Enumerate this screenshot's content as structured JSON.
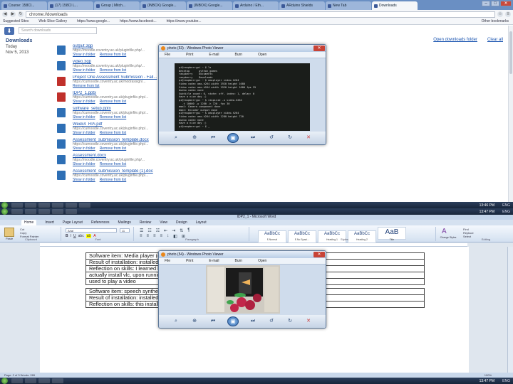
{
  "browser": {
    "tabs": [
      "Course: 158CI...",
      "(17) 158CI L...",
      "Group | Mitch...",
      "(INBOX) Google...",
      "(INBOX) Google...",
      "Arduino / Eth...",
      "ARduino Shields",
      "New Tab",
      "Downloads"
    ],
    "active_tab": 8,
    "address": "chrome://downloads",
    "bookmarks": [
      "Suggested Sites",
      "Web Slice Gallery",
      "https://www.google...",
      "https://www.facebook...",
      "https://www.youtube..."
    ],
    "other_bookmarks": "Other bookmarks",
    "window_buttons": {
      "min": "–",
      "max": "□",
      "close": "✕"
    }
  },
  "downloads": {
    "search_placeholder": "Search downloads",
    "title": "Downloads",
    "open_folder": "Open downloads folder",
    "clear_all": "Clear all",
    "date_label": "Today",
    "date_value": "Nov 5, 2013",
    "items": [
      {
        "name": "output.3gp",
        "url": "https://moodle.coventry.ac.uk/pluginfile.php/...",
        "show": "Show in folder",
        "remove": "Remove from list",
        "icon_color": "#2e6fb5"
      },
      {
        "name": "video.3gp",
        "url": "https://moodle.coventry.ac.uk/pluginfile.php/...",
        "show": "Show in folder",
        "remove": "Remove from list",
        "icon_color": "#2e6fb5"
      },
      {
        "name": "Project One Assessment Submission - Fall...",
        "url": "https://cumoodle.coventry.ac.uk/mod/assign/...",
        "show": "Remove from list",
        "remove": "",
        "icon_color": "#c0302b"
      },
      {
        "name": "IDP2_1.pptx",
        "url": "https://cumoodle.coventry.ac.uk/pluginfile.php/...",
        "show": "Show in folder",
        "remove": "Remove from list",
        "icon_color": "#c0302b"
      },
      {
        "name": "software_setup.pptx",
        "url": "https://cumoodle.coventry.ac.uk/pluginfile.php/...",
        "show": "Show in folder",
        "remove": "Remove from list",
        "icon_color": "#2e6fb5"
      },
      {
        "name": "Week4_RPi.pdf",
        "url": "https://cumoodle.coventry.ac.uk/pluginfile.php/...",
        "show": "Show in folder",
        "remove": "Remove from list",
        "icon_color": "#2e6fb5"
      },
      {
        "name": "Assessment_submission_template.docx",
        "url": "https://cumoodle.coventry.ac.uk/pluginfile.php/...",
        "show": "Show in folder",
        "remove": "Remove from list",
        "icon_color": "#2e6fb5"
      },
      {
        "name": "Assessment.docx",
        "url": "https://moodle.coventry.ac.uk/pluginfile.php/...",
        "show": "Show in folder",
        "remove": "Remove from list",
        "icon_color": "#2e6fb5"
      },
      {
        "name": "Assessment_submission_template (1).doc",
        "url": "https://cumoodle.coventry.ac.uk/pluginfile.php/...",
        "show": "Show in folder",
        "remove": "Remove from list",
        "icon_color": "#2e6fb5"
      }
    ]
  },
  "taskbar": {
    "clock_top": "13:46 PM",
    "clock_bottom": "13:47 PM",
    "lang": "ENG"
  },
  "player1": {
    "title": "photo (53) - Windows Photo Viewer",
    "menu": [
      "File",
      "Print",
      "E-mail",
      "Burn",
      "Open"
    ],
    "terminal": "pi@raspberrypi ~ $ ls\nDesktop      python_games\nraspberry    Documents\nraspberry    Downloads\npi@raspberrypi ~ $ omxplayer video.h264\nVideo codec omx-h264 width 1920 height 1080\nVideo codec omx-h264 width 1920 height 1080 fps 25\nAudio codec none\nSubtitle count: 0, state: off, index: 1, delay: 0\nhave a nice day ;)\npi@raspberrypi ~ $ raspivid -o video.h264\n  -t 10000 -w 1280 -h 720 -fps 30\nmmal: Camera component done\nmmal: Encoder output done\npi@raspberrypi ~ $ omxplayer video.h264\nVideo codec omx-h264 width 1280 height 720\nAudio codec none\nhave a nice day ;)\npi@raspberrypi ~ $ _"
  },
  "player2": {
    "title": "photo (54) - Windows Photo Viewer",
    "menu": [
      "File",
      "Print",
      "E-mail",
      "Burn",
      "Open"
    ]
  },
  "word": {
    "title": "IDP2_1 - Microsoft Word",
    "tabs": [
      "Home",
      "Insert",
      "Page Layout",
      "References",
      "Mailings",
      "Review",
      "View",
      "Design",
      "Layout"
    ],
    "font": "Arial",
    "size": "11",
    "clipboard": {
      "paste": "Paste",
      "cut": "Cut",
      "copy": "Copy",
      "painter": "Format Painter",
      "label": "Clipboard"
    },
    "font_label": "Font",
    "paragraph_label": "Paragraph",
    "styles_label": "Styles",
    "editing": {
      "find": "Find",
      "replace": "Replace",
      "select": "Select",
      "label": "Editing"
    },
    "styles": [
      {
        "sample": "AaBbCc",
        "name": "¶ Normal"
      },
      {
        "sample": "AaBbCc",
        "name": "¶ No Spaci..."
      },
      {
        "sample": "AaBbCc",
        "name": "Heading 1"
      },
      {
        "sample": "AaBbCc",
        "name": "Heading 2"
      },
      {
        "sample": "AaB",
        "name": "Title"
      },
      {
        "sample": "AaBbCc",
        "name": "Subtitle"
      }
    ],
    "change_styles": "Change Styles",
    "table1": [
      "Software item: Media player (omxplayer)",
      "Result of installation: installed without issue",
      "Reflection on skills: I learned how to use the commands. I could",
      "actually install vlc, upon running the video, this was a plus for me. I",
      "used to play a video"
    ],
    "table2": [
      "Software item: speech synthesizer",
      "Result of installation: installed",
      "Reflection on skills: this installation was optional."
    ],
    "status": "Page: 2 of 3   Words: 289",
    "zoom": "100%"
  }
}
